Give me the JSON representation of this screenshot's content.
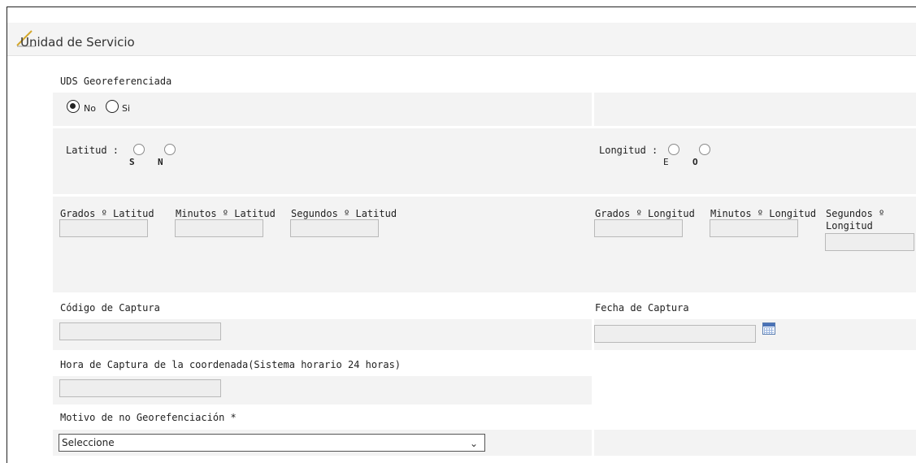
{
  "section": {
    "title": "Unidad de Servicio",
    "icon": "pencil-icon"
  },
  "uds_georef": {
    "label": "UDS Georeferenciada",
    "options": [
      {
        "label": "No",
        "checked": true
      },
      {
        "label": "Si",
        "checked": false
      }
    ]
  },
  "latitud": {
    "label": "Latitud :",
    "options": [
      "S",
      "N"
    ]
  },
  "longitud": {
    "label": "Longitud :",
    "options": [
      "E",
      "O"
    ]
  },
  "coords": {
    "grados_lat": {
      "label": "Grados º Latitud",
      "value": ""
    },
    "minutos_lat": {
      "label": "Minutos º Latitud",
      "value": ""
    },
    "segundos_lat": {
      "label": "Segundos º Latitud",
      "value": ""
    },
    "grados_lon": {
      "label": "Grados º Longitud",
      "value": ""
    },
    "minutos_lon": {
      "label": "Minutos º Longitud",
      "value": ""
    },
    "segundos_lon_line1": "Segundos º",
    "segundos_lon_line2": "Longitud"
  },
  "captura": {
    "codigo_label": "Código de Captura",
    "fecha_label": "Fecha de Captura",
    "hora_label": "Hora de Captura de la coordenada(Sistema horario 24 horas)",
    "calendar_icon": "calendar-icon"
  },
  "motivo": {
    "label": "Motivo de no Georefenciación *",
    "selected": "Seleccione"
  },
  "colors": {
    "band": "#f3f3f3",
    "input_bg": "#eeeeee",
    "input_border": "#b9b9b9"
  }
}
